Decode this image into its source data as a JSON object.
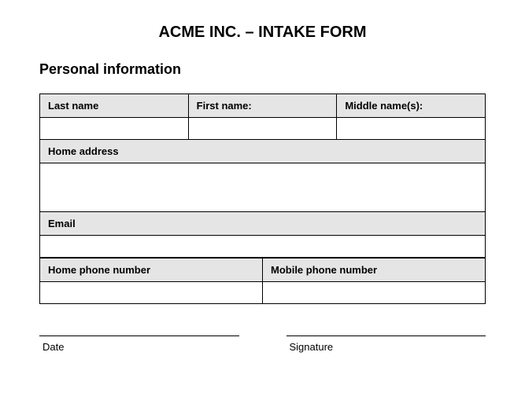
{
  "title": "ACME INC. – INTAKE FORM",
  "section_heading": "Personal information",
  "fields": {
    "last_name": {
      "label": "Last name",
      "value": ""
    },
    "first_name": {
      "label": "First name:",
      "value": ""
    },
    "middle_names": {
      "label": "Middle name(s):",
      "value": ""
    },
    "home_address": {
      "label": "Home address",
      "value": ""
    },
    "email": {
      "label": "Email",
      "value": ""
    },
    "home_phone": {
      "label": "Home phone number",
      "value": ""
    },
    "mobile_phone": {
      "label": "Mobile phone number",
      "value": ""
    }
  },
  "signature": {
    "date_label": "Date",
    "signature_label": "Signature"
  }
}
